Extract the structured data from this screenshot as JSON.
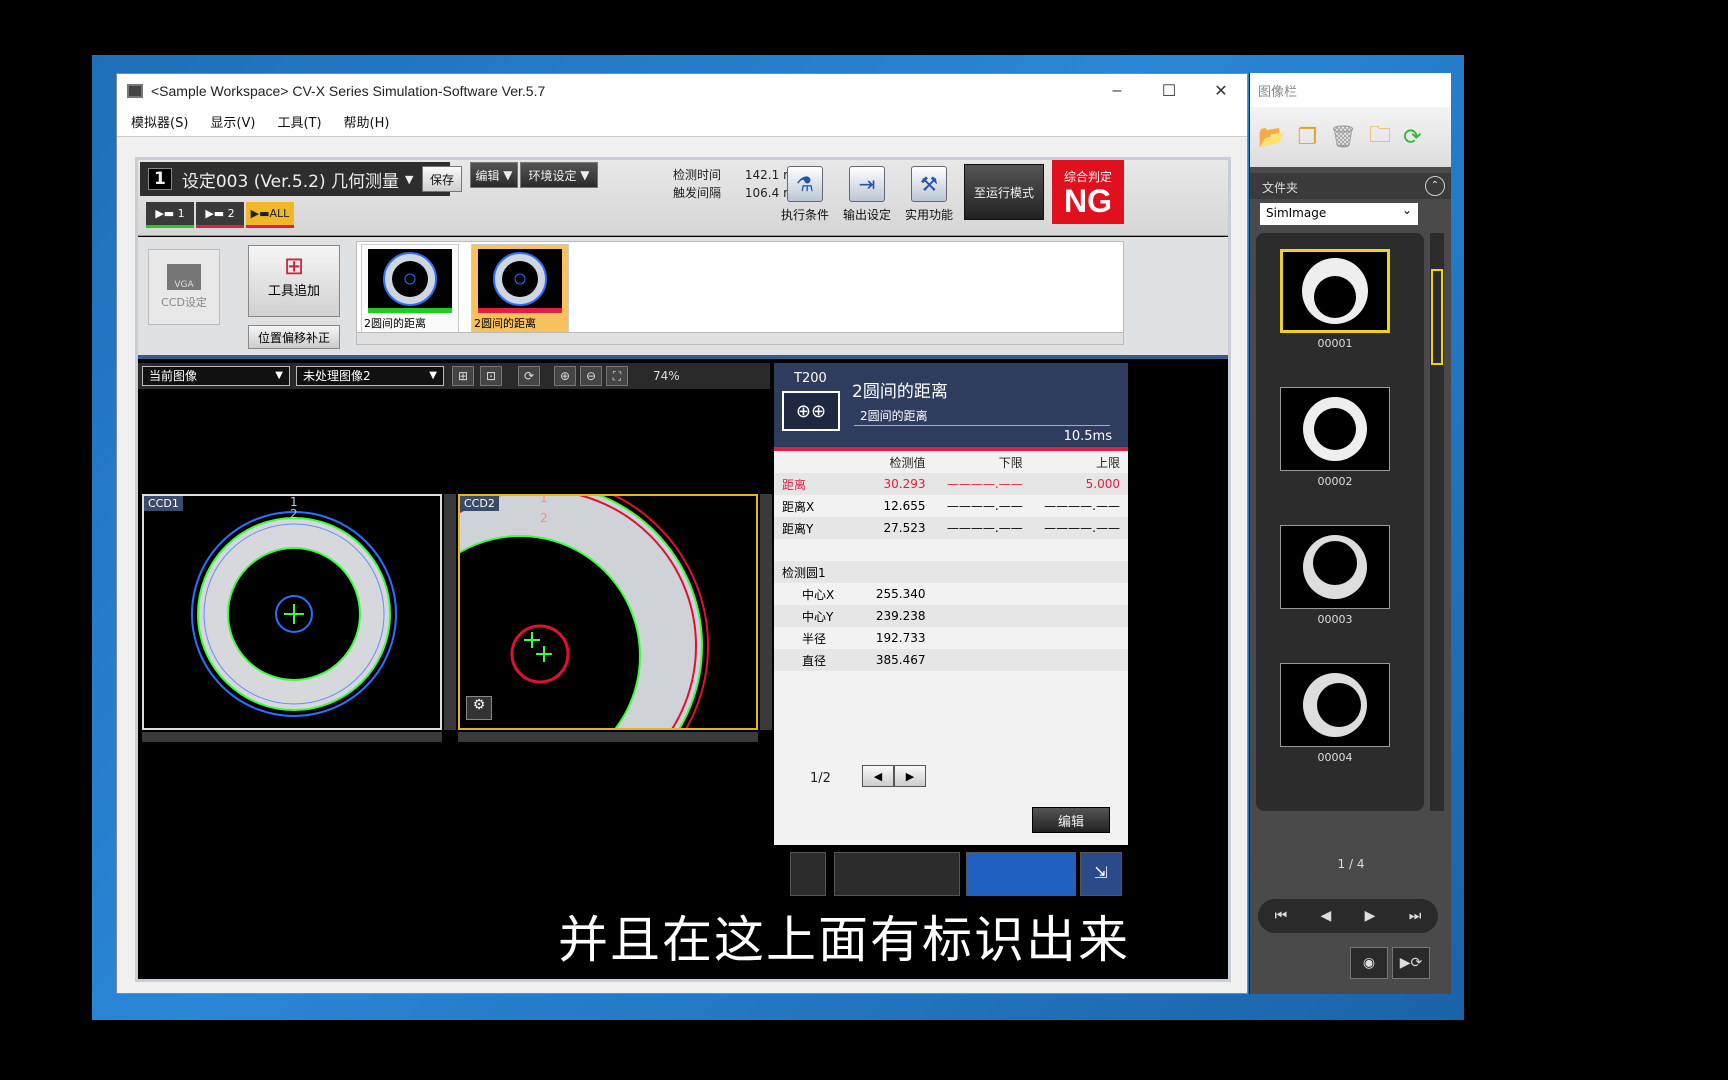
{
  "window": {
    "title": "<Sample Workspace> CV-X Series Simulation-Software Ver.5.7",
    "menus": [
      "模拟器(S)",
      "显示(V)",
      "工具(T)",
      "帮助(H)"
    ]
  },
  "toolbar": {
    "setting_no": "1",
    "setting_name": "设定003 (Ver.5.2) 几何测量",
    "save": "保存",
    "edit": "编辑",
    "env": "环境设定",
    "cam_tabs": [
      "1",
      "2",
      "ALL"
    ],
    "detect_time_label": "检测时间",
    "detect_time": "142.1 ms",
    "trigger_label": "触发间隔",
    "trigger": "106.4 ms",
    "exec_cond": "执行条件",
    "output_set": "输出设定",
    "util": "实用功能",
    "run_mode": "至运行模式",
    "judge_label": "综合判定",
    "judge": "NG"
  },
  "toolstrip": {
    "ccd_label": "CCD设定",
    "vga": "VGA",
    "tool_add": "工具追加",
    "pos_fix": "位置偏移补正",
    "cards": [
      {
        "label": "2圆间的距离"
      },
      {
        "label": "2圆间的距离"
      }
    ]
  },
  "imagebar": {
    "view": "当前图像",
    "source": "未处理图像2",
    "zoom": "74%",
    "ccd1": "CCD1",
    "ccd2": "CCD2"
  },
  "result": {
    "tool_id": "T200",
    "tool_name": "2圆间的距离",
    "tool_sub": "2圆间的距离",
    "time": "10.5ms",
    "headers": [
      "检测值",
      "下限",
      "上限"
    ],
    "rows": [
      {
        "name": "距离",
        "val": "30.293",
        "low": "————.——",
        "high": "5.000",
        "ng": true
      },
      {
        "name": "距离X",
        "val": "12.655",
        "low": "————.——",
        "high": "————.——"
      },
      {
        "name": "距离Y",
        "val": "27.523",
        "low": "————.——",
        "high": "————.——"
      }
    ],
    "group": "检测圆1",
    "detail": [
      {
        "name": "中心X",
        "val": "255.340"
      },
      {
        "name": "中心Y",
        "val": "239.238"
      },
      {
        "name": "半径",
        "val": "192.733"
      },
      {
        "name": "直径",
        "val": "385.467"
      }
    ],
    "page": "1/2",
    "edit": "编辑"
  },
  "subtitle": "并且在这上面有标识出来",
  "imgpanel": {
    "title": "图像栏",
    "folder_label": "文件夹",
    "folder": "SimImage",
    "thumbs": [
      "00001",
      "00002",
      "00003",
      "00004"
    ],
    "page": "1 / 4"
  }
}
